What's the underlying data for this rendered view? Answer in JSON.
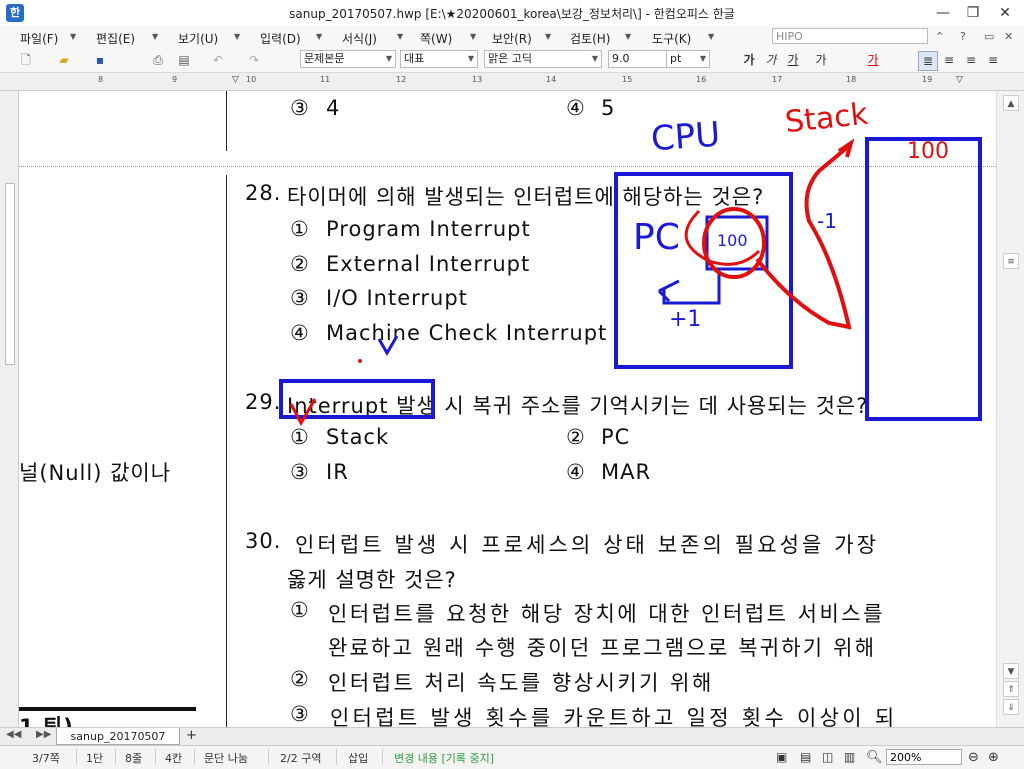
{
  "window": {
    "title": "sanup_20170507.hwp [E:\\★20200601_korea\\보강_정보처리\\] - 한컴오피스 한글",
    "icon": "hwp-app-icon",
    "min": "—",
    "max": "❐",
    "close": "✕"
  },
  "menu": {
    "items": [
      "파일(F)",
      "편집(E)",
      "보기(U)",
      "입력(D)",
      "서식(J)",
      "쪽(W)",
      "보안(R)",
      "검토(H)",
      "도구(K)"
    ],
    "search_value": "HIPO"
  },
  "toolbar": {
    "style": "문제본문",
    "font_kind": "대표",
    "font": "맑은 고딕",
    "size": "9.0",
    "unit": "pt",
    "bold": "가",
    "italic": "가",
    "underline": "가",
    "strike": "가",
    "color": "가"
  },
  "ruler": {
    "numbers": [
      "8",
      "9",
      "10",
      "11",
      "12",
      "13",
      "14",
      "15",
      "16",
      "17",
      "18",
      "19"
    ]
  },
  "document": {
    "left_column_text": "널(Null) 값이나",
    "left_bottom_fragment": "1 ᄐᆡ)",
    "q27_opts": [
      {
        "marker": "③",
        "text": "4"
      },
      {
        "marker": "④",
        "text": "5"
      }
    ],
    "q28": {
      "number": "28.",
      "text": "타이머에 의해 발생되는 인터럽트에 해당하는 것은?",
      "options": [
        {
          "marker": "①",
          "text": "Program Interrupt"
        },
        {
          "marker": "②",
          "text": "External Interrupt"
        },
        {
          "marker": "③",
          "text": "I/O Interrupt"
        },
        {
          "marker": "④",
          "text": "Machine Check Interrupt"
        }
      ]
    },
    "q29": {
      "number": "29.",
      "text": "Interrupt 발생 시 복귀 주소를 기억시키는 데 사용되는 것은?",
      "options": [
        {
          "marker": "①",
          "text": "Stack"
        },
        {
          "marker": "②",
          "text": "PC"
        },
        {
          "marker": "③",
          "text": "IR"
        },
        {
          "marker": "④",
          "text": "MAR"
        }
      ]
    },
    "q30": {
      "number": "30.",
      "line1": "인터럽트 발생 시 프로세스의 상태 보존의 필요성을 가장",
      "line2": "옳게 설명한 것은?",
      "options": [
        {
          "marker": "①",
          "text": "인터럽트를 요청한 해당 장치에 대한 인터럽트 서비스를",
          "cont": "완료하고 원래 수행 중이던 프로그램으로 복귀하기 위해"
        },
        {
          "marker": "②",
          "text": "인터럽트 처리 속도를 향상시키기 위해"
        },
        {
          "marker": "③",
          "text": "인터럽트 발생 횟수를 카운트하고 일정 횟수 이상이 되"
        }
      ]
    },
    "annotations": {
      "cpu": "CPU",
      "stack": "Stack",
      "hundred": "100",
      "pc": "PC",
      "pc_value": "100",
      "minus": "-1",
      "plus": "+1"
    }
  },
  "tabs": {
    "doc_tab": "sanup_20170507",
    "add": "+"
  },
  "status": {
    "page": "3/7쪽",
    "column": "1단",
    "line": "8줄",
    "col": "4칸",
    "para": "문단 나눔",
    "section": "2/2 구역",
    "insert": "삽입",
    "track": "변경 내용 [기록 중지]",
    "zoom": "200%"
  },
  "colors": {
    "annotation_blue": "#1a1ad6",
    "annotation_red": "#e01010",
    "track_text": "#2f9e3a"
  }
}
